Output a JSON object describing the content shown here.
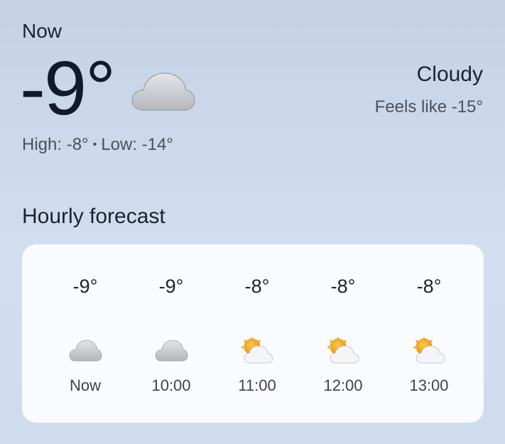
{
  "current": {
    "section_label": "Now",
    "temperature": "-9°",
    "condition": "Cloudy",
    "feels_like": "Feels like -15°",
    "high": "High: -8°",
    "separator": "•",
    "low": "Low: -14°",
    "icon": "cloud-icon"
  },
  "hourly": {
    "title": "Hourly forecast",
    "items": [
      {
        "temp": "-9°",
        "time": "Now",
        "icon": "cloud-icon"
      },
      {
        "temp": "-9°",
        "time": "10:00",
        "icon": "cloud-icon"
      },
      {
        "temp": "-8°",
        "time": "11:00",
        "icon": "partly-cloudy-icon"
      },
      {
        "temp": "-8°",
        "time": "12:00",
        "icon": "partly-cloudy-icon"
      },
      {
        "temp": "-8°",
        "time": "13:00",
        "icon": "partly-cloudy-icon"
      }
    ]
  },
  "colors": {
    "card_background": "#fafbfe",
    "sun": "#f0a818",
    "cloud": "#d4d6da"
  }
}
